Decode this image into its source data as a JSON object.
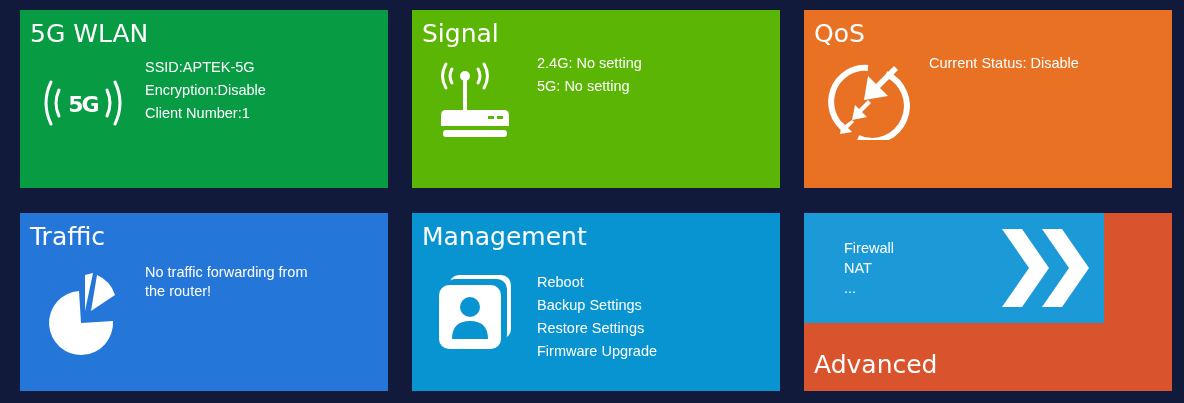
{
  "tiles": [
    {
      "kind": "info",
      "title": "5G WLAN",
      "color": "#079b43",
      "icon_label": "5G",
      "lines": [
        "SSID:APTEK-5G",
        "Encryption:Disable",
        "Client Number:1"
      ]
    },
    {
      "kind": "info",
      "title": "Signal",
      "color": "#5bb504",
      "lines": [
        "2.4G: No setting",
        "5G: No setting"
      ]
    },
    {
      "kind": "info",
      "title": "QoS",
      "color": "#e87124",
      "lines": [
        "Current Status: Disable"
      ]
    },
    {
      "kind": "info",
      "title": "Traffic",
      "color": "#2477d9",
      "lines": [
        "No traffic forwarding from the router!"
      ]
    },
    {
      "kind": "info",
      "title": "Management",
      "color": "#0894d0",
      "lines": [
        "Reboot",
        "Backup Settings",
        "Restore Settings",
        "Firmware Upgrade"
      ]
    },
    {
      "kind": "advanced",
      "title": "Advanced",
      "color": "#d9532c",
      "lines": [
        "Firewall",
        "NAT",
        "..."
      ]
    }
  ]
}
